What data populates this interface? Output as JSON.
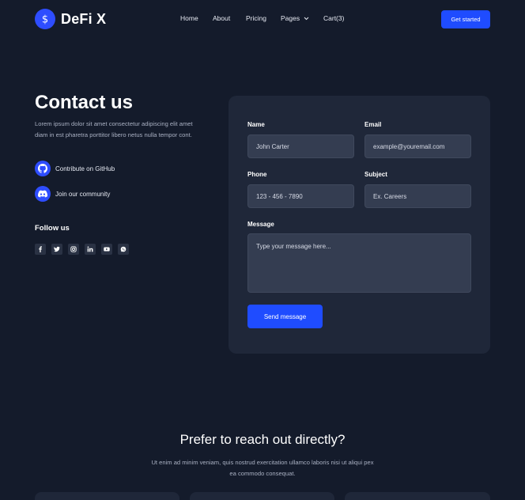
{
  "brand": {
    "name": "DeFi X",
    "accent": "#1f4cff"
  },
  "nav": {
    "items": [
      "Home",
      "About",
      "Pricing",
      "Pages",
      "Cart(3)"
    ],
    "cta": "Get started"
  },
  "contact": {
    "title": "Contact us",
    "description": "Lorem ipsum dolor sit amet consectetur adipiscing elit amet diam in est pharetra porttitor libero netus nulla tempor cont.",
    "links": [
      {
        "label": "Contribute on GitHub",
        "icon": "github-icon"
      },
      {
        "label": "Join our community",
        "icon": "discord-icon"
      }
    ],
    "follow_label": "Follow us",
    "socials": [
      "facebook-icon",
      "twitter-icon",
      "instagram-icon",
      "linkedin-icon",
      "youtube-icon",
      "whatsapp-icon"
    ]
  },
  "form": {
    "name_label": "Name",
    "name_value": "John Carter",
    "email_label": "Email",
    "email_placeholder": "example@youremail.com",
    "phone_label": "Phone",
    "phone_placeholder": "123 - 456 - 7890",
    "subject_label": "Subject",
    "subject_placeholder": "Ex. Careers",
    "message_label": "Message",
    "message_placeholder": "Type your message here...",
    "submit": "Send message"
  },
  "direct": {
    "title": "Prefer to reach out directly?",
    "description": "Ut enim ad minim veniam, quis nostrud exercitation ullamco laboris nisi ut aliqui pex ea commodo consequat."
  }
}
